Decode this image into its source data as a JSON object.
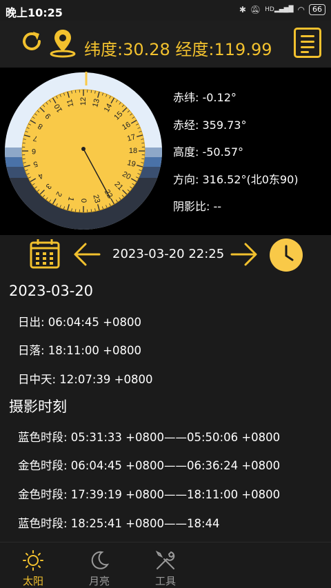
{
  "status": {
    "time": "晚上10:25",
    "hd": "HD",
    "battery": "66"
  },
  "header": {
    "coords": "纬度:30.28 经度:119.99"
  },
  "dial": {
    "numbers_top": [
      "1",
      "2",
      "3",
      "4",
      "5",
      "6",
      "7",
      "8",
      "9",
      "10",
      "11",
      "12",
      "13",
      "14",
      "15",
      "16",
      "17",
      "18",
      "19",
      "20",
      "21",
      "22",
      "23",
      "0"
    ]
  },
  "sun": {
    "declination": "赤纬: -0.12°",
    "right_ascension": "赤经: 359.73°",
    "altitude": "高度: -50.57°",
    "azimuth": "方向: 316.52°(北0东90)",
    "shadow_ratio": "阴影比: --"
  },
  "datebar": {
    "datetime": "2023-03-20 22:25"
  },
  "day": {
    "date": "2023-03-20",
    "sunrise": "日出: 06:04:45 +0800",
    "sunset": "日落: 18:11:00 +0800",
    "noon": "日中天: 12:07:39 +0800"
  },
  "photo": {
    "title": "摄影时刻",
    "items": [
      "蓝色时段: 05:31:33 +0800——05:50:06 +0800",
      "金色时段: 06:04:45 +0800——06:36:24 +0800",
      "金色时段: 17:39:19 +0800——18:11:00 +0800",
      "蓝色时段: 18:25:41 +0800——18:44"
    ]
  },
  "tabs": [
    {
      "label": "太阳",
      "icon": "sun-icon",
      "active": true
    },
    {
      "label": "月亮",
      "icon": "moon-icon",
      "active": false
    },
    {
      "label": "工具",
      "icon": "tools-icon",
      "active": false
    }
  ],
  "colors": {
    "accent": "#f2c12e",
    "background": "#1b1b1b",
    "panel": "#000000"
  }
}
